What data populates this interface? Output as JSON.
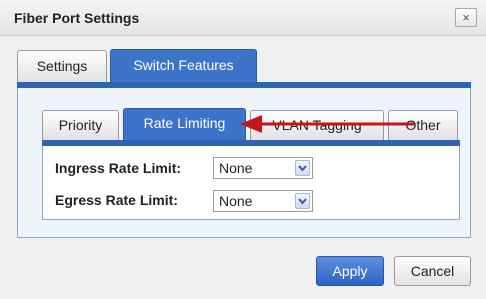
{
  "dialog": {
    "title": "Fiber Port Settings",
    "close_icon": "×"
  },
  "outer_tabs": [
    {
      "label": "Settings",
      "active": false
    },
    {
      "label": "Switch Features",
      "active": true
    }
  ],
  "inner_tabs": [
    {
      "label": "Priority",
      "active": false
    },
    {
      "label": "Rate Limiting",
      "active": true
    },
    {
      "label": "VLAN Tagging",
      "active": false
    },
    {
      "label": "Other",
      "active": false
    }
  ],
  "fields": {
    "ingress": {
      "label": "Ingress Rate Limit:",
      "value": "None"
    },
    "egress": {
      "label": "Egress Rate Limit:",
      "value": "None"
    }
  },
  "buttons": {
    "apply": "Apply",
    "cancel": "Cancel"
  },
  "colors": {
    "accent": "#3b74c8",
    "annotation_arrow": "#c0161c"
  }
}
